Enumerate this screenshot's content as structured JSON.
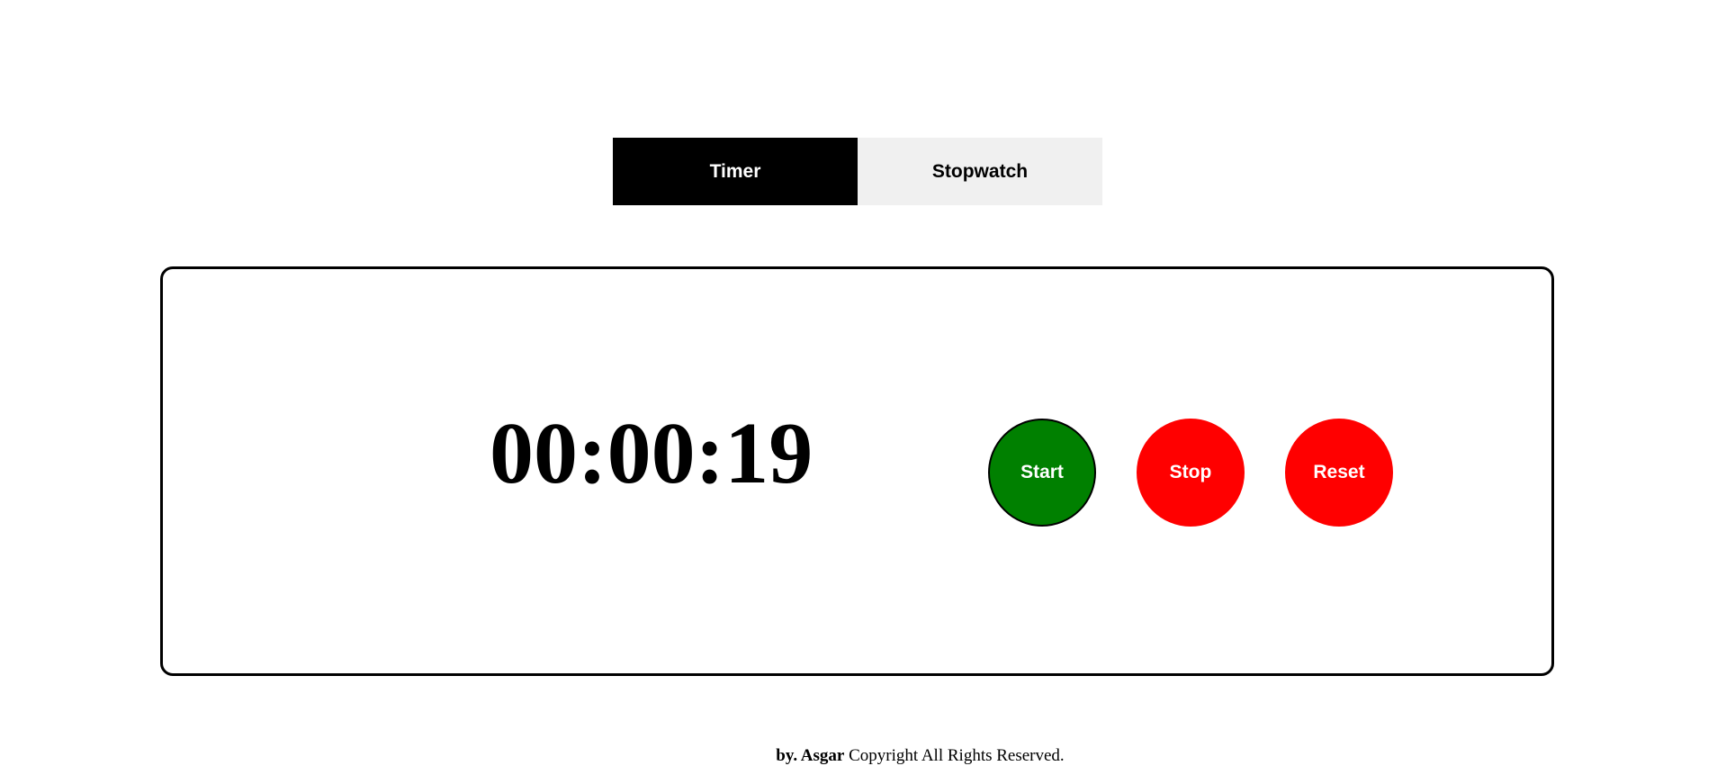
{
  "tabs": [
    {
      "label": "Timer",
      "active": true
    },
    {
      "label": "Stopwatch",
      "active": false
    }
  ],
  "display": {
    "time": "00:00:19"
  },
  "controls": {
    "start_label": "Start",
    "stop_label": "Stop",
    "reset_label": "Reset"
  },
  "footer": {
    "author": "by. Asgar",
    "text": "Copyright All Rights Reserved."
  },
  "colors": {
    "start": "#008000",
    "stop": "#ff0000",
    "reset": "#ff0000",
    "active_tab": "#000000",
    "inactive_tab": "#f0f0f0"
  }
}
